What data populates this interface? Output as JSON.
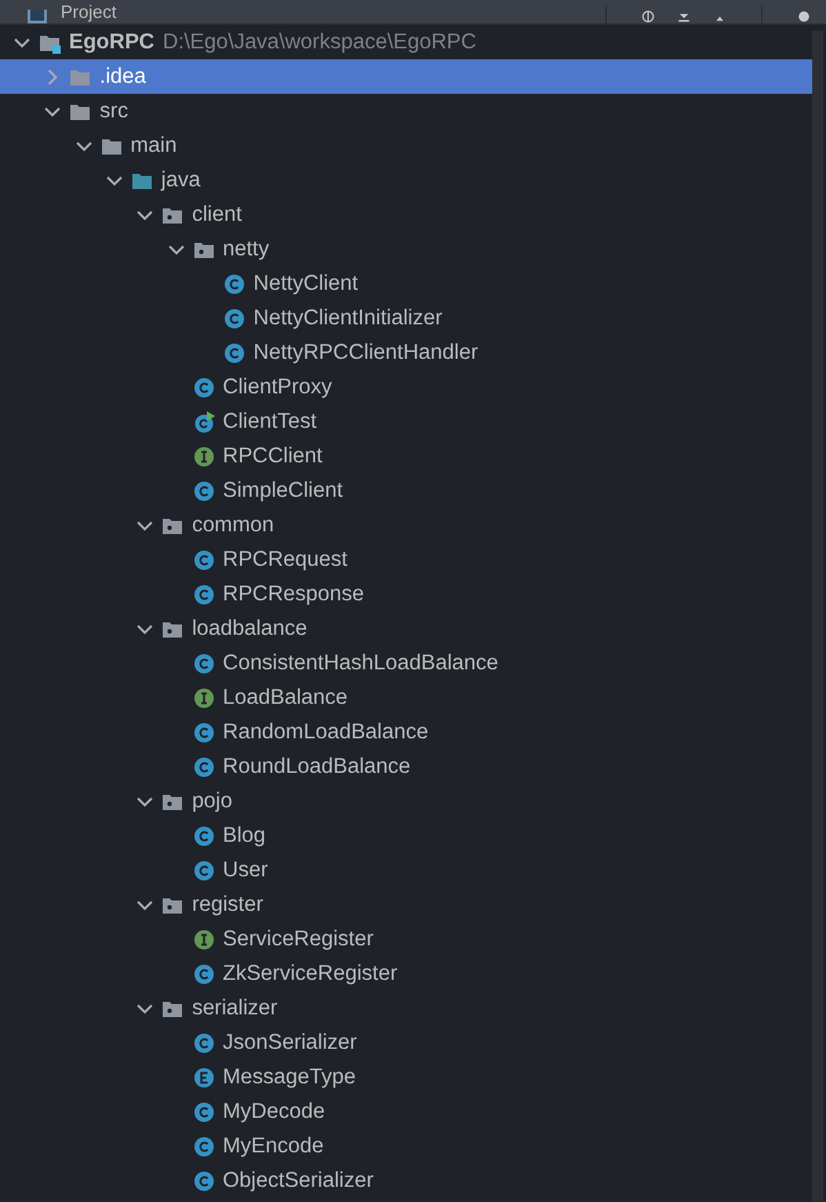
{
  "panel": {
    "title": "Project"
  },
  "tree": [
    {
      "name": "EgoRPC",
      "path": "D:\\Ego\\Java\\workspace\\EgoRPC",
      "kind": "module",
      "expanded": true,
      "selected": false,
      "children": [
        {
          "name": ".idea",
          "kind": "folder",
          "expanded": false,
          "selected": true
        },
        {
          "name": "src",
          "kind": "folder",
          "expanded": true,
          "selected": false,
          "children": [
            {
              "name": "main",
              "kind": "folder",
              "expanded": true,
              "selected": false,
              "children": [
                {
                  "name": "java",
                  "kind": "source_folder",
                  "expanded": true,
                  "selected": false,
                  "children": [
                    {
                      "name": "client",
                      "kind": "package",
                      "expanded": true,
                      "selected": false,
                      "children": [
                        {
                          "name": "netty",
                          "kind": "package",
                          "expanded": true,
                          "selected": false,
                          "children": [
                            {
                              "name": "NettyClient",
                              "kind": "class",
                              "selected": false
                            },
                            {
                              "name": "NettyClientInitializer",
                              "kind": "class",
                              "selected": false
                            },
                            {
                              "name": "NettyRPCClientHandler",
                              "kind": "class",
                              "selected": false
                            }
                          ]
                        },
                        {
                          "name": "ClientProxy",
                          "kind": "class",
                          "selected": false
                        },
                        {
                          "name": "ClientTest",
                          "kind": "runnable_class",
                          "selected": false
                        },
                        {
                          "name": "RPCClient",
                          "kind": "interface",
                          "selected": false
                        },
                        {
                          "name": "SimpleClient",
                          "kind": "class",
                          "selected": false
                        }
                      ]
                    },
                    {
                      "name": "common",
                      "kind": "package",
                      "expanded": true,
                      "selected": false,
                      "children": [
                        {
                          "name": "RPCRequest",
                          "kind": "class",
                          "selected": false
                        },
                        {
                          "name": "RPCResponse",
                          "kind": "class",
                          "selected": false
                        }
                      ]
                    },
                    {
                      "name": "loadbalance",
                      "kind": "package",
                      "expanded": true,
                      "selected": false,
                      "children": [
                        {
                          "name": "ConsistentHashLoadBalance",
                          "kind": "class",
                          "selected": false
                        },
                        {
                          "name": "LoadBalance",
                          "kind": "interface",
                          "selected": false
                        },
                        {
                          "name": "RandomLoadBalance",
                          "kind": "class",
                          "selected": false
                        },
                        {
                          "name": "RoundLoadBalance",
                          "kind": "class",
                          "selected": false
                        }
                      ]
                    },
                    {
                      "name": "pojo",
                      "kind": "package",
                      "expanded": true,
                      "selected": false,
                      "children": [
                        {
                          "name": "Blog",
                          "kind": "class",
                          "selected": false
                        },
                        {
                          "name": "User",
                          "kind": "class",
                          "selected": false
                        }
                      ]
                    },
                    {
                      "name": "register",
                      "kind": "package",
                      "expanded": true,
                      "selected": false,
                      "children": [
                        {
                          "name": "ServiceRegister",
                          "kind": "interface",
                          "selected": false
                        },
                        {
                          "name": "ZkServiceRegister",
                          "kind": "class",
                          "selected": false
                        }
                      ]
                    },
                    {
                      "name": "serializer",
                      "kind": "package",
                      "expanded": true,
                      "selected": false,
                      "children": [
                        {
                          "name": "JsonSerializer",
                          "kind": "class",
                          "selected": false
                        },
                        {
                          "name": "MessageType",
                          "kind": "enum",
                          "selected": false
                        },
                        {
                          "name": "MyDecode",
                          "kind": "class",
                          "selected": false
                        },
                        {
                          "name": "MyEncode",
                          "kind": "class",
                          "selected": false
                        },
                        {
                          "name": "ObjectSerializer",
                          "kind": "class",
                          "selected": false
                        }
                      ]
                    }
                  ]
                }
              ]
            }
          ]
        }
      ]
    }
  ]
}
